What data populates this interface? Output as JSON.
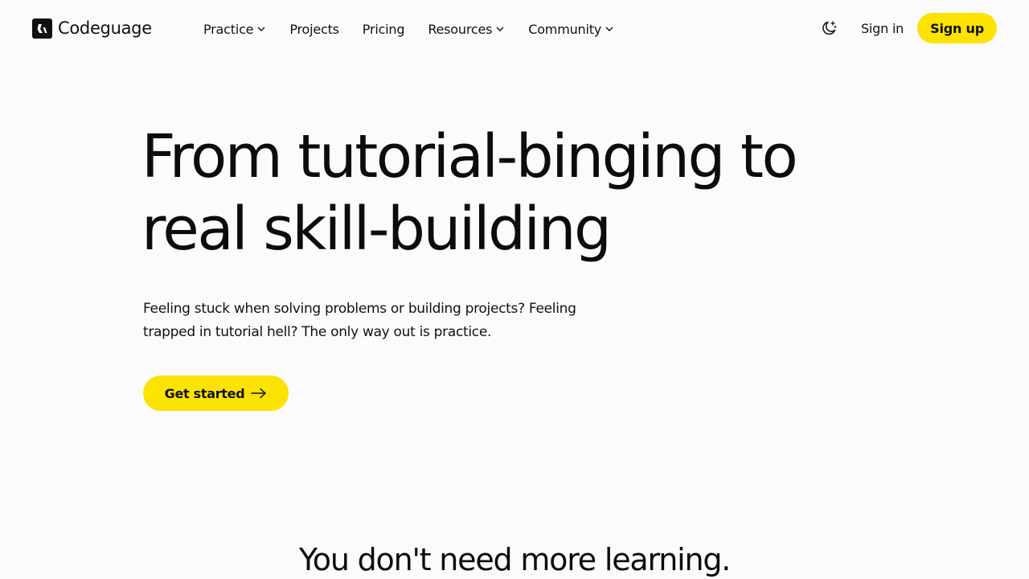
{
  "brand": {
    "name": "Codeguage",
    "accent_color": "#fce300",
    "logo_icon": "codeguage-logo-icon"
  },
  "nav": {
    "items": [
      {
        "label": "Practice",
        "has_dropdown": true
      },
      {
        "label": "Projects",
        "has_dropdown": false
      },
      {
        "label": "Pricing",
        "has_dropdown": false
      },
      {
        "label": "Resources",
        "has_dropdown": true
      },
      {
        "label": "Community",
        "has_dropdown": true
      }
    ],
    "theme_toggle_icon": "moon-stars-icon",
    "signin_label": "Sign in",
    "signup_label": "Sign up"
  },
  "hero": {
    "title_line1": "From tutorial-binging to",
    "title_line2": "real skill-building",
    "subtitle_line1": "Feeling stuck when solving problems or building projects? Feeling",
    "subtitle_line2": "trapped in tutorial hell? The only way out is practice.",
    "cta_label": "Get started",
    "cta_icon": "arrow-right-icon"
  },
  "next_section": {
    "title": "You don't need more learning."
  }
}
